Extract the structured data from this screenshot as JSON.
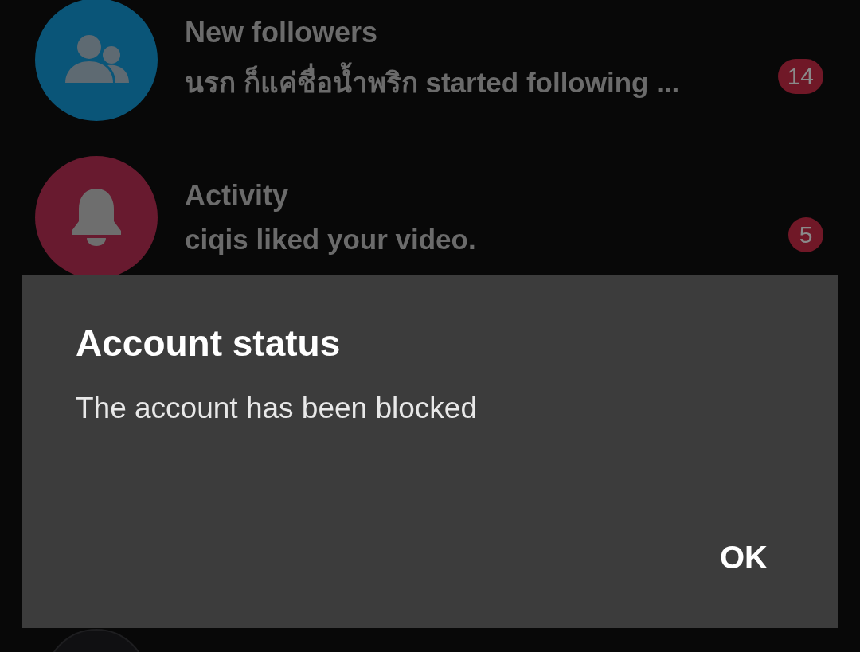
{
  "conversations": [
    {
      "kind": "followers",
      "title": "New followers",
      "preview": "นรก ก็แค่ชื่อน้ำพริก started following ...",
      "badge": "14"
    },
    {
      "kind": "activity",
      "title": "Activity",
      "preview": "ciqis liked your video.",
      "badge": "5"
    },
    {
      "kind": "photo"
    }
  ],
  "dialog": {
    "title": "Account status",
    "message": "The account has been blocked",
    "button": "OK"
  }
}
